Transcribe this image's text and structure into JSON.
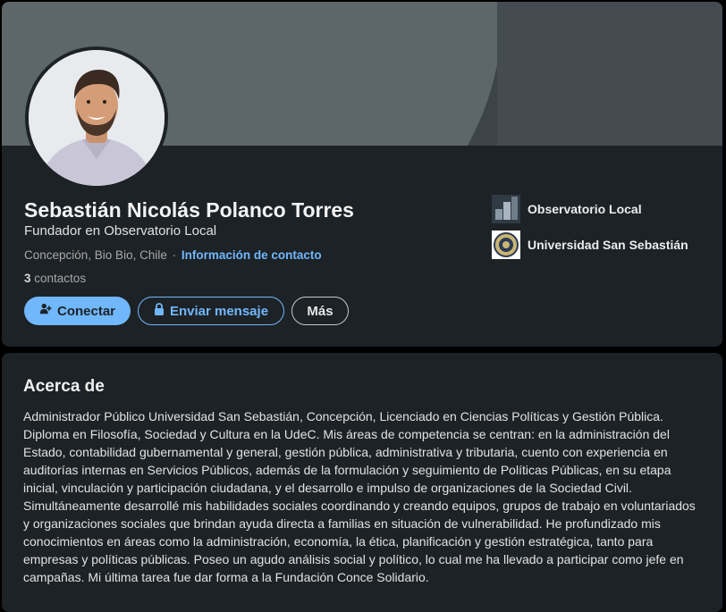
{
  "profile": {
    "name": "Sebastián Nicolás Polanco Torres",
    "headline": "Fundador en Observatorio Local",
    "location": "Concepción, Bio Bio, Chile",
    "separator": "·",
    "contact_info_link": "Información de contacto",
    "contacts_count": "3",
    "contacts_label": "contactos",
    "buttons": {
      "connect": "Conectar",
      "message": "Enviar mensaje",
      "more": "Más"
    },
    "organizations": [
      {
        "name": "Observatorio Local",
        "logo": "observatorio-logo"
      },
      {
        "name": "Universidad San Sebastián",
        "logo": "uss-seal"
      }
    ]
  },
  "about": {
    "title": "Acerca de",
    "text": "Administrador Público Universidad San Sebastián, Concepción, Licenciado en Ciencias Políticas y Gestión Pública. Diploma en Filosofía, Sociedad y Cultura en la UdeC. Mis áreas de competencia se centran: en la administración del Estado, contabilidad gubernamental y general, gestión pública, administrativa y tributaria, cuento con experiencia en auditorías internas en Servicios Públicos, además de la formulación y seguimiento de Políticas Públicas, en su etapa inicial, vinculación y participación ciudadana, y el desarrollo e impulso de organizaciones de la Sociedad Civil. Simultáneamente desarrollé mis habilidades sociales coordinando y creando equipos, grupos de trabajo en voluntariados y organizaciones sociales que brindan ayuda directa a familias en situación de vulnerabilidad. He profundizado mis conocimientos en áreas como la administración, economía, la ética, planificación y gestión estratégica, tanto para empresas y políticas públicas. Poseo un agudo análisis social y político, lo cual me ha llevado a participar como jefe en campañas. Mi última tarea fue dar forma a la Fundación Conce Solidario."
  },
  "colors": {
    "card_bg": "#1d2226",
    "accent_blue": "#71b7fb",
    "banner": "#5d6668"
  }
}
